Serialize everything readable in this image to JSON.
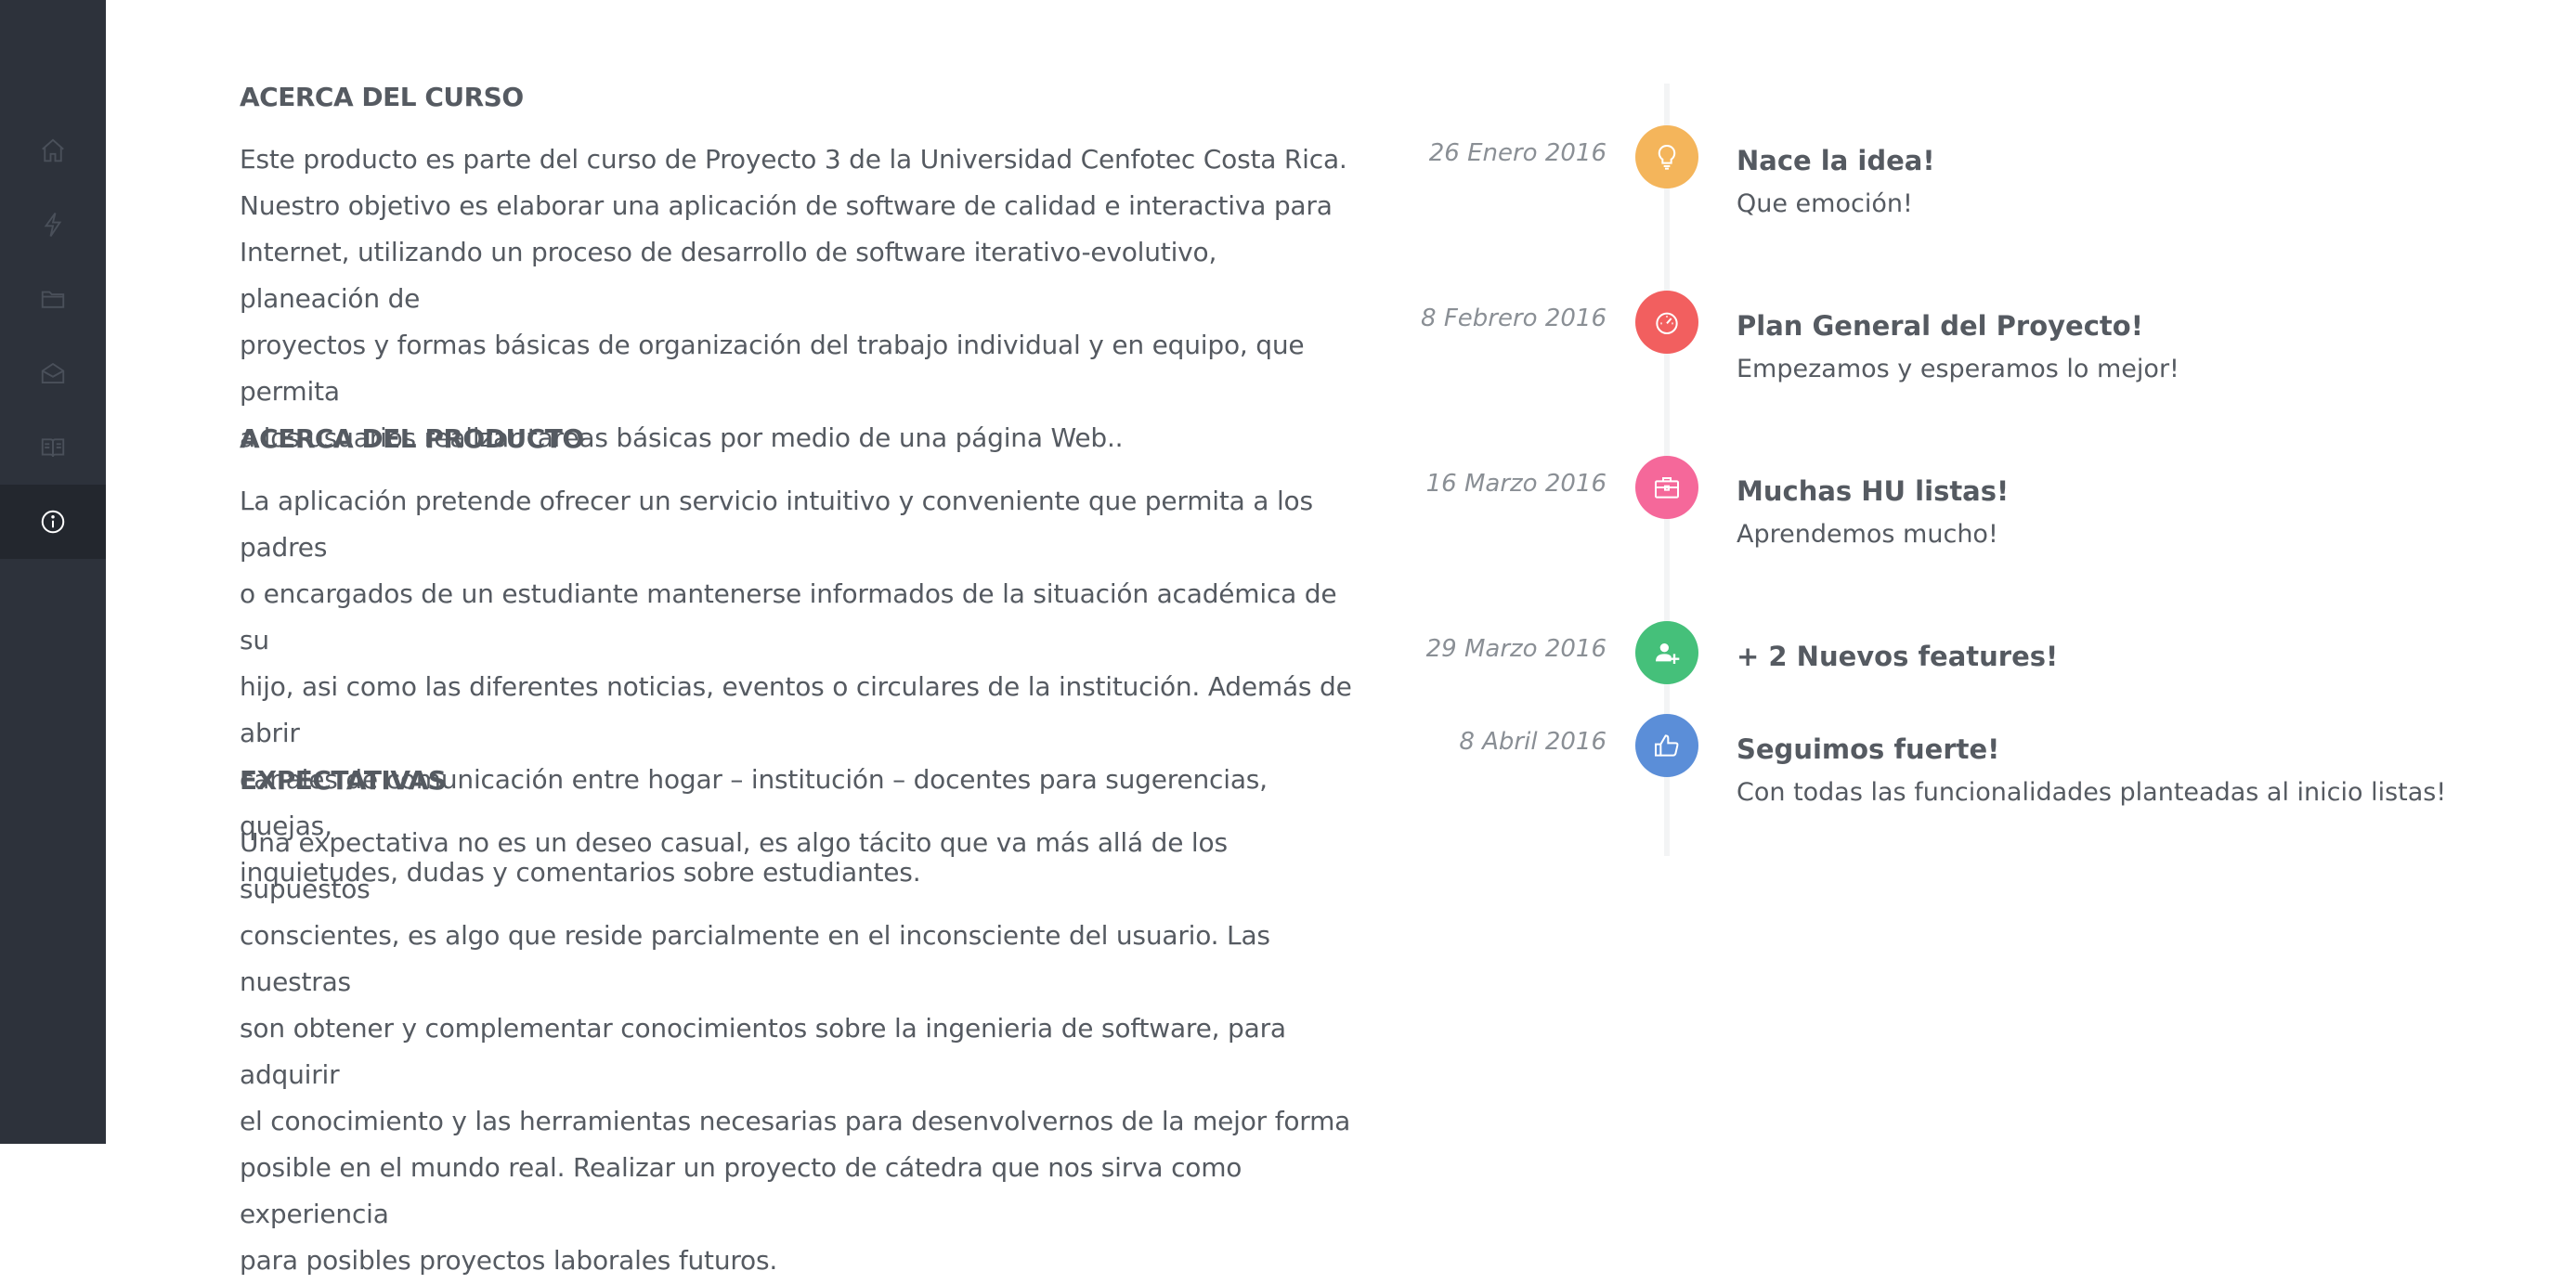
{
  "sidebar": {
    "items": [
      {
        "icon": "home-icon"
      },
      {
        "icon": "lightning-icon"
      },
      {
        "icon": "folder-icon"
      },
      {
        "icon": "mail-icon"
      },
      {
        "icon": "book-icon"
      },
      {
        "icon": "info-icon",
        "active": true
      }
    ]
  },
  "sections": [
    {
      "heading": "ACERCA DEL CURSO",
      "lines": [
        "Este producto es parte del curso de Proyecto 3 de la Universidad Cenfotec Costa Rica.",
        "Nuestro objetivo es elaborar una aplicación de software de calidad e interactiva para",
        "Internet, utilizando un proceso de desarrollo de software iterativo-evolutivo, planeación de",
        "proyectos y formas básicas de organización del trabajo individual y en equipo, que permita",
        "a los usuarios realizar tareas básicas por medio de una página Web.."
      ]
    },
    {
      "heading": "ACERCA DEL PRODUCTO",
      "lines": [
        "La aplicación pretende ofrecer un servicio intuitivo y conveniente que permita a los padres",
        "o encargados de un estudiante mantenerse informados de la situación académica de su",
        "hijo, asi como las diferentes noticias, eventos o circulares de la institución. Además de abrir",
        "canales de comunicación entre hogar – institución – docentes para sugerencias, quejas,",
        "inquietudes, dudas y comentarios sobre estudiantes."
      ]
    },
    {
      "heading": "EXPECTATIVAS",
      "lines": [
        "Una expectativa no es un deseo casual, es algo tácito que va más allá de los supuestos",
        "conscientes, es algo que reside parcialmente en el inconsciente del usuario. Las nuestras",
        "son obtener y complementar conocimientos sobre la ingenieria de software, para adquirir",
        "el conocimiento y las herramientas necesarias para desenvolvernos de la mejor forma",
        "posible en el mundo real. Realizar un proyecto de cátedra que nos sirva como experiencia",
        "para posibles proyectos laborales futuros."
      ]
    }
  ],
  "timeline": [
    {
      "date": "26 Enero 2016",
      "title": "Nace la idea!",
      "subtitle": "Que emoción!",
      "color": "#f4b55b",
      "icon": "lightbulb-icon"
    },
    {
      "date": "8 Febrero 2016",
      "title": "Plan General del Proyecto!",
      "subtitle": "Empezamos y esperamos lo mejor!",
      "color": "#f25f5f",
      "icon": "speedometer-icon"
    },
    {
      "date": "16 Marzo 2016",
      "title": "Muchas HU listas!",
      "subtitle": "Aprendemos mucho!",
      "color": "#f5689a",
      "icon": "briefcase-icon"
    },
    {
      "date": "29 Marzo 2016",
      "title": "+ 2 Nuevos features!",
      "subtitle": "",
      "color": "#45c07a",
      "icon": "user-add-icon"
    },
    {
      "date": "8 Abril 2016",
      "title": "Seguimos fuerte!",
      "subtitle": "Con todas las funcionalidades planteadas al inicio listas!",
      "color": "#5b8ed8",
      "icon": "thumbs-up-icon"
    }
  ]
}
